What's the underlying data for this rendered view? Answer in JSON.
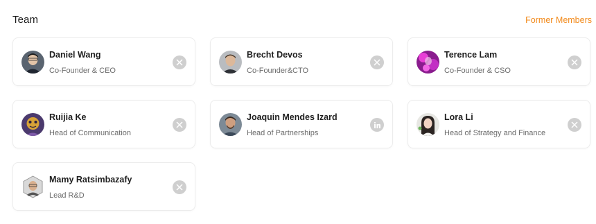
{
  "header": {
    "title": "Team",
    "former_members_label": "Former Members"
  },
  "colors": {
    "accent": "#f28a1b",
    "social_icon_bg": "#cfcfcf"
  },
  "members": [
    {
      "name": "Daniel Wang",
      "role": "Co-Founder & CEO",
      "social": "x-icon"
    },
    {
      "name": "Brecht Devos",
      "role": "Co-Founder&CTO",
      "social": "x-icon"
    },
    {
      "name": "Terence Lam",
      "role": "Co-Founder & CSO",
      "social": "x-icon"
    },
    {
      "name": "Ruijia Ke",
      "role": "Head of Communication",
      "social": "x-icon"
    },
    {
      "name": "Joaquin Mendes Izard",
      "role": "Head of Partnerships",
      "social": "linkedin-icon"
    },
    {
      "name": "Lora Li",
      "role": "Head of Strategy and Finance",
      "social": "x-icon"
    },
    {
      "name": "Mamy Ratsimbazafy",
      "role": "Lead R&D",
      "social": "x-icon"
    }
  ]
}
